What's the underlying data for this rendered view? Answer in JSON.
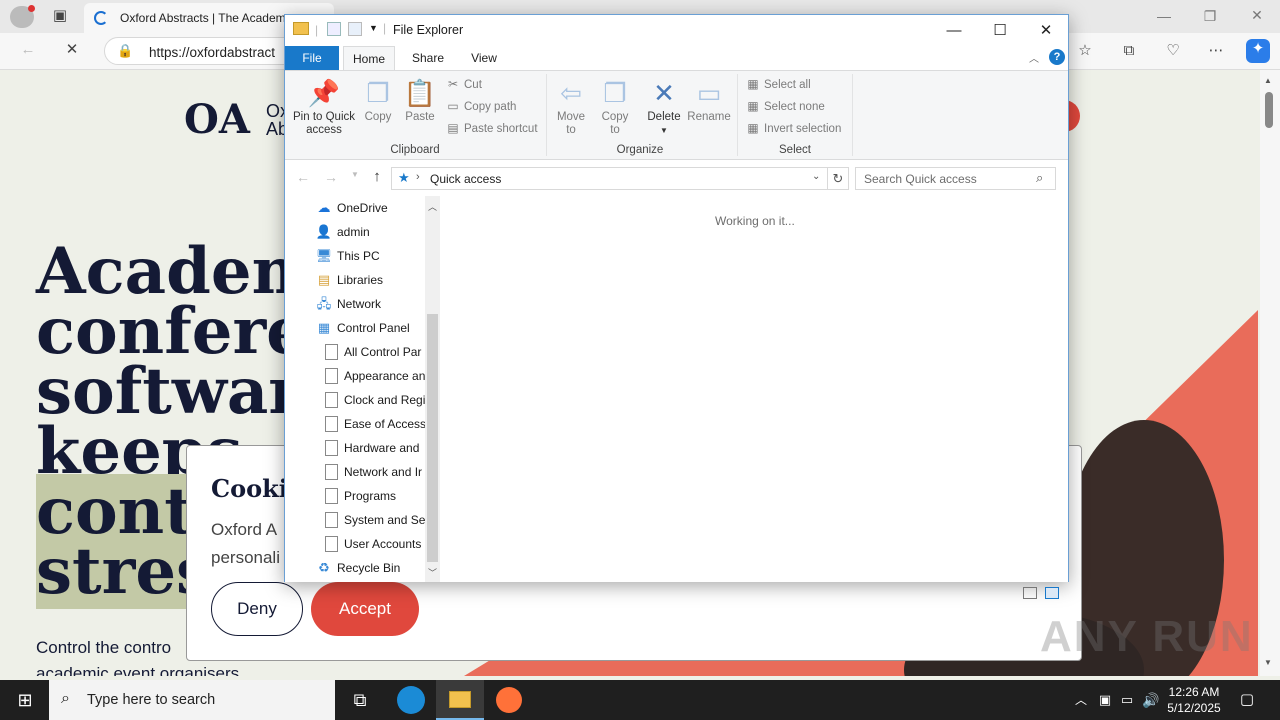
{
  "browser": {
    "tab_title": "Oxford Abstracts | The Academ",
    "url": "https://oxfordabstract",
    "icons": [
      "profile-icon",
      "tab-actions-icon",
      "back-icon",
      "stop-loading-icon",
      "lock-icon",
      "read-aloud-icon",
      "favorites-icon",
      "collections-icon",
      "performance-icon",
      "more-icon",
      "copilot-icon"
    ]
  },
  "website": {
    "logo_mark": "OA",
    "logo_text_1": "Ox",
    "logo_text_2": "Ab",
    "hero": [
      "Academi",
      "conferen",
      "software",
      "keeps",
      "contr",
      "stress"
    ],
    "subtext_1": "Control the contro",
    "subtext_2": "academic event organisers",
    "cookie": {
      "title": "Cookie",
      "body_1": "Oxford A",
      "body_2": "personali",
      "deny": "Deny",
      "accept": "Accept"
    },
    "colors": {
      "navy": "#141a35",
      "accent": "#e0483d",
      "highlight": "#c3c9a6",
      "background": "#eef0e8"
    }
  },
  "explorer": {
    "title": "File Explorer",
    "tabs": [
      "File",
      "Home",
      "Share",
      "View"
    ],
    "ribbon": {
      "pin_label_1": "Pin to Quick",
      "pin_label_2": "access",
      "copy": "Copy",
      "paste": "Paste",
      "cut": "Cut",
      "copy_path": "Copy path",
      "paste_shortcut": "Paste shortcut",
      "move_to_1": "Move",
      "move_to_2": "to",
      "copy_to_1": "Copy",
      "copy_to_2": "to",
      "delete": "Delete",
      "rename": "Rename",
      "select_all": "Select all",
      "select_none": "Select none",
      "invert_selection": "Invert selection",
      "group_clipboard": "Clipboard",
      "group_organize": "Organize",
      "group_select": "Select"
    },
    "address": "Quick access",
    "search_placeholder": "Search Quick access",
    "status": "Working on it...",
    "nav_items": [
      {
        "label": "OneDrive",
        "icon": "onedrive-icon"
      },
      {
        "label": "admin",
        "icon": "user-folder-icon"
      },
      {
        "label": "This PC",
        "icon": "this-pc-icon"
      },
      {
        "label": "Libraries",
        "icon": "libraries-icon"
      },
      {
        "label": "Network",
        "icon": "network-icon"
      },
      {
        "label": "Control Panel",
        "icon": "control-panel-icon"
      }
    ],
    "control_panel_items": [
      "All Control Par",
      "Appearance an",
      "Clock and Regi",
      "Ease of Access",
      "Hardware and",
      "Network and Ir",
      "Programs",
      "System and Sec",
      "User Accounts"
    ],
    "recycle_bin": "Recycle Bin"
  },
  "taskbar": {
    "search_placeholder": "Type here to search",
    "time": "12:26 AM",
    "date": "5/12/2025"
  },
  "watermark": "ANY RUN"
}
